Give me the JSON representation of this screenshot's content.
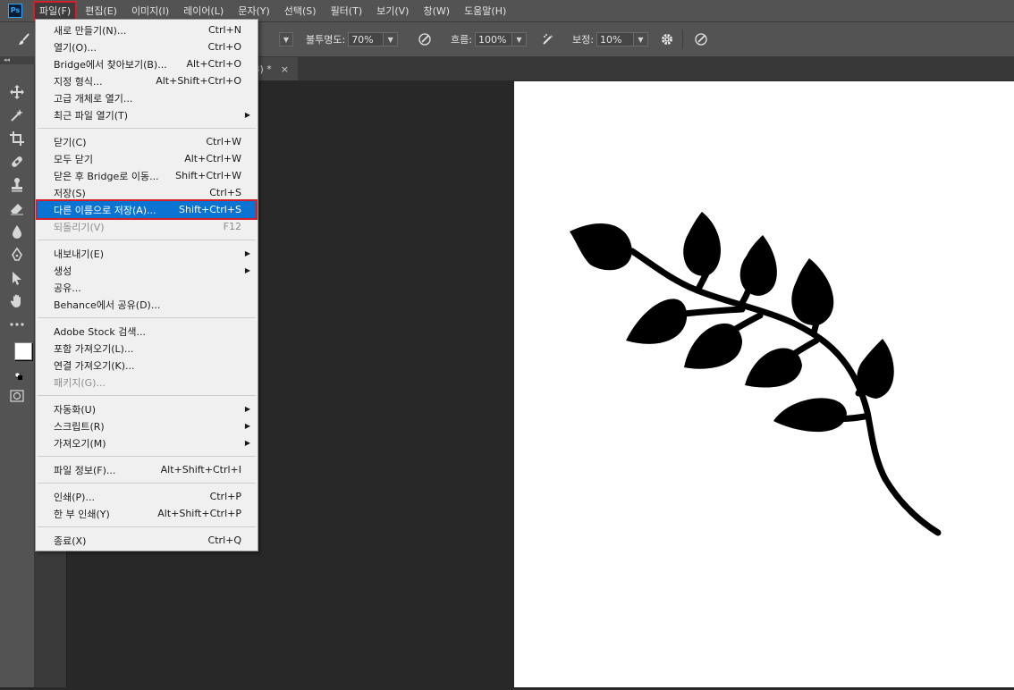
{
  "app": {
    "logo_text": "Ps",
    "accent": "#31a8ff",
    "highlight_outline": "#d2202a"
  },
  "menubar": {
    "items": [
      {
        "label": "파일(F)",
        "active": true
      },
      {
        "label": "편집(E)"
      },
      {
        "label": "이미지(I)"
      },
      {
        "label": "레이어(L)"
      },
      {
        "label": "문자(Y)"
      },
      {
        "label": "선택(S)"
      },
      {
        "label": "필터(T)"
      },
      {
        "label": "보기(V)"
      },
      {
        "label": "창(W)"
      },
      {
        "label": "도움말(H)"
      }
    ]
  },
  "options": {
    "opacity_label": "불투명도:",
    "opacity_value": "70%",
    "flow_label": "흐름:",
    "flow_value": "100%",
    "smoothing_label": "보정:",
    "smoothing_value": "10%"
  },
  "document_tab": {
    "title_fragment": "8) *",
    "close_glyph": "×"
  },
  "toolbar": {
    "collapse_glyph": "◂◂",
    "tools": [
      "move-icon",
      "magic-wand-icon",
      "crop-icon",
      "healing-brush-icon",
      "stamp-icon",
      "eraser-icon",
      "blur-icon",
      "pen-icon",
      "path-select-icon",
      "hand-icon",
      "more-tools-icon"
    ]
  },
  "file_menu": {
    "items": [
      {
        "label": "새로 만들기(N)...",
        "shortcut": "Ctrl+N"
      },
      {
        "label": "열기(O)...",
        "shortcut": "Ctrl+O"
      },
      {
        "label": "Bridge에서 찾아보기(B)...",
        "shortcut": "Alt+Ctrl+O"
      },
      {
        "label": "지정 형식...",
        "shortcut": "Alt+Shift+Ctrl+O"
      },
      {
        "label": "고급 개체로 열기..."
      },
      {
        "label": "최근 파일 열기(T)",
        "submenu": true
      },
      {
        "label": "닫기(C)",
        "shortcut": "Ctrl+W"
      },
      {
        "label": "모두 닫기",
        "shortcut": "Alt+Ctrl+W"
      },
      {
        "label": "닫은 후 Bridge로 이동...",
        "shortcut": "Shift+Ctrl+W"
      },
      {
        "label": "저장(S)",
        "shortcut": "Ctrl+S"
      },
      {
        "label": "다른 이름으로 저장(A)...",
        "shortcut": "Shift+Ctrl+S",
        "highlighted": true
      },
      {
        "label": "되돌리기(V)",
        "shortcut": "F12",
        "disabled": true
      },
      {
        "label": "내보내기(E)",
        "submenu": true
      },
      {
        "label": "생성",
        "submenu": true
      },
      {
        "label": "공유..."
      },
      {
        "label": "Behance에서 공유(D)..."
      },
      {
        "label": "Adobe Stock 검색..."
      },
      {
        "label": "포함 가져오기(L)..."
      },
      {
        "label": "연결 가져오기(K)..."
      },
      {
        "label": "패키지(G)...",
        "disabled": true
      },
      {
        "label": "자동화(U)",
        "submenu": true
      },
      {
        "label": "스크립트(R)",
        "submenu": true
      },
      {
        "label": "가져오기(M)",
        "submenu": true
      },
      {
        "label": "파일 정보(F)...",
        "shortcut": "Alt+Shift+Ctrl+I"
      },
      {
        "label": "인쇄(P)...",
        "shortcut": "Ctrl+P"
      },
      {
        "label": "한 부 인쇄(Y)",
        "shortcut": "Alt+Shift+Ctrl+P"
      },
      {
        "label": "종료(X)",
        "shortcut": "Ctrl+Q"
      }
    ]
  }
}
